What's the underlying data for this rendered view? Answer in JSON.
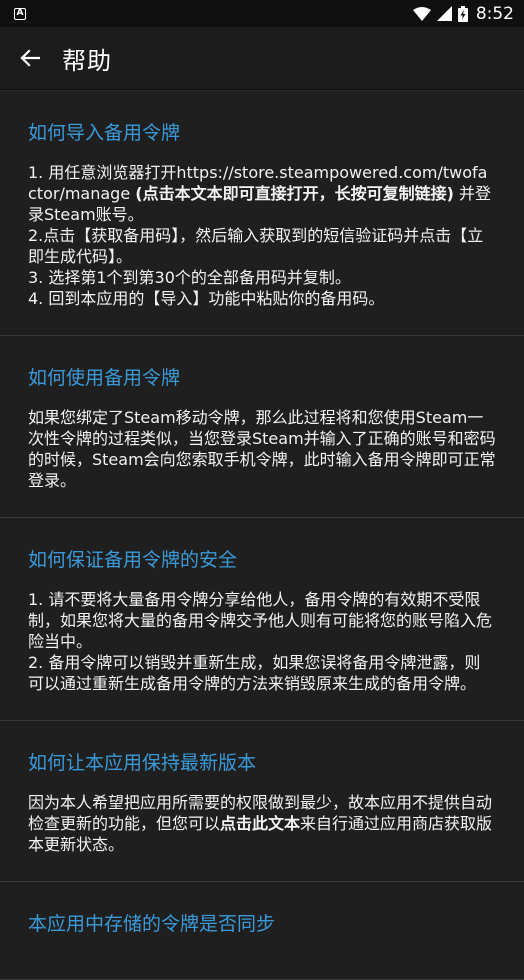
{
  "status_bar": {
    "notification_icon_letter": "A",
    "time": "8:52"
  },
  "app_bar": {
    "back_icon": "arrow-back-icon",
    "title": "帮助"
  },
  "sections": [
    {
      "title": "如何导入备用令牌",
      "lines": {
        "l1_pre": "1. 用任意浏览器打开https://store.steampowered.com/twofactor/manage ",
        "l1_link": "(点击本文本即可直接打开，长按可复制链接)",
        "l1_post": " 并登录Steam账号。",
        "l2": "2.点击【获取备用码】，然后输入获取到的短信验证码并点击【立即生成代码】。",
        "l3": "3. 选择第1个到第30个的全部备用码并复制。",
        "l4": "4. 回到本应用的【导入】功能中粘贴你的备用码。"
      }
    },
    {
      "title": "如何使用备用令牌",
      "body": "如果您绑定了Steam移动令牌，那么此过程将和您使用Steam一次性令牌的过程类似，当您登录Steam并输入了正确的账号和密码的时候，Steam会向您索取手机令牌，此时输入备用令牌即可正常登录。"
    },
    {
      "title": "如何保证备用令牌的安全",
      "lines": {
        "l1": "1. 请不要将大量备用令牌分享给他人，备用令牌的有效期不受限制，如果您将大量的备用令牌交予他人则有可能将您的账号陷入危险当中。",
        "l2": "2. 备用令牌可以销毁并重新生成，如果您误将备用令牌泄露，则可以通过重新生成备用令牌的方法来销毁原来生成的备用令牌。"
      }
    },
    {
      "title": "如何让本应用保持最新版本",
      "body_pre": "因为本人希望把应用所需要的权限做到最少，故本应用不提供自动检查更新的功能，但您可以",
      "body_link": "点击此文本",
      "body_post": "来自行通过应用商店获取版本更新状态。"
    },
    {
      "title": "本应用中存储的令牌是否同步"
    }
  ]
}
